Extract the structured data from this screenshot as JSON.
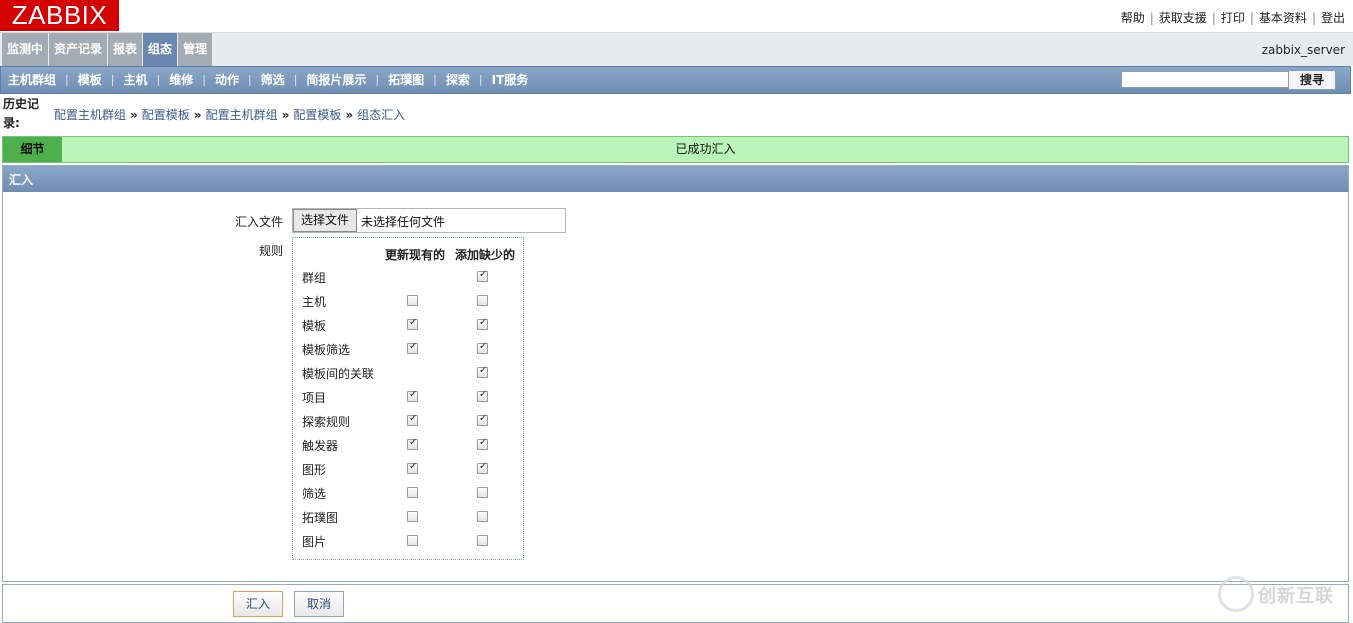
{
  "logo": "ZABBIX",
  "top_links": [
    "帮助",
    "获取支援",
    "打印",
    "基本资料",
    "登出"
  ],
  "main_menu": [
    {
      "label": "监测中",
      "active": false
    },
    {
      "label": "资产记录",
      "active": false
    },
    {
      "label": "报表",
      "active": false
    },
    {
      "label": "组态",
      "active": true
    },
    {
      "label": "管理",
      "active": false
    }
  ],
  "server_name": "zabbix_server",
  "sub_menu": [
    "主机群组",
    "模板",
    "主机",
    "维修",
    "动作",
    "筛选",
    "简报片展示",
    "拓璞图",
    "探索",
    "IT服务"
  ],
  "search": {
    "value": "",
    "button_label": "搜寻"
  },
  "history": {
    "label": "历史记录:",
    "crumbs": [
      "配置主机群组",
      "配置模板",
      "配置主机群组",
      "配置模板"
    ],
    "current": "组态汇入",
    "separator": "»"
  },
  "message": {
    "details_label": "细节",
    "text": "已成功汇入",
    "color": "#b9f5b9"
  },
  "form": {
    "title": "汇入",
    "file_label": "汇入文件",
    "file_button": "选择文件",
    "file_status": "未选择任何文件",
    "rules_label": "规则",
    "col_update": "更新现有的",
    "col_add": "添加缺少的",
    "rules": [
      {
        "name": "群组",
        "update": null,
        "add": true
      },
      {
        "name": "主机",
        "update": false,
        "add": false
      },
      {
        "name": "模板",
        "update": true,
        "add": true
      },
      {
        "name": "模板筛选",
        "update": true,
        "add": true
      },
      {
        "name": "模板间的关联",
        "update": null,
        "add": true
      },
      {
        "name": "项目",
        "update": true,
        "add": true
      },
      {
        "name": "探索规则",
        "update": true,
        "add": true
      },
      {
        "name": "触发器",
        "update": true,
        "add": true
      },
      {
        "name": "图形",
        "update": true,
        "add": true
      },
      {
        "name": "筛选",
        "update": false,
        "add": false
      },
      {
        "name": "拓璞图",
        "update": false,
        "add": false
      },
      {
        "name": "图片",
        "update": false,
        "add": false
      }
    ]
  },
  "buttons": {
    "import": "汇入",
    "cancel": "取消"
  },
  "watermark": "创新互联"
}
